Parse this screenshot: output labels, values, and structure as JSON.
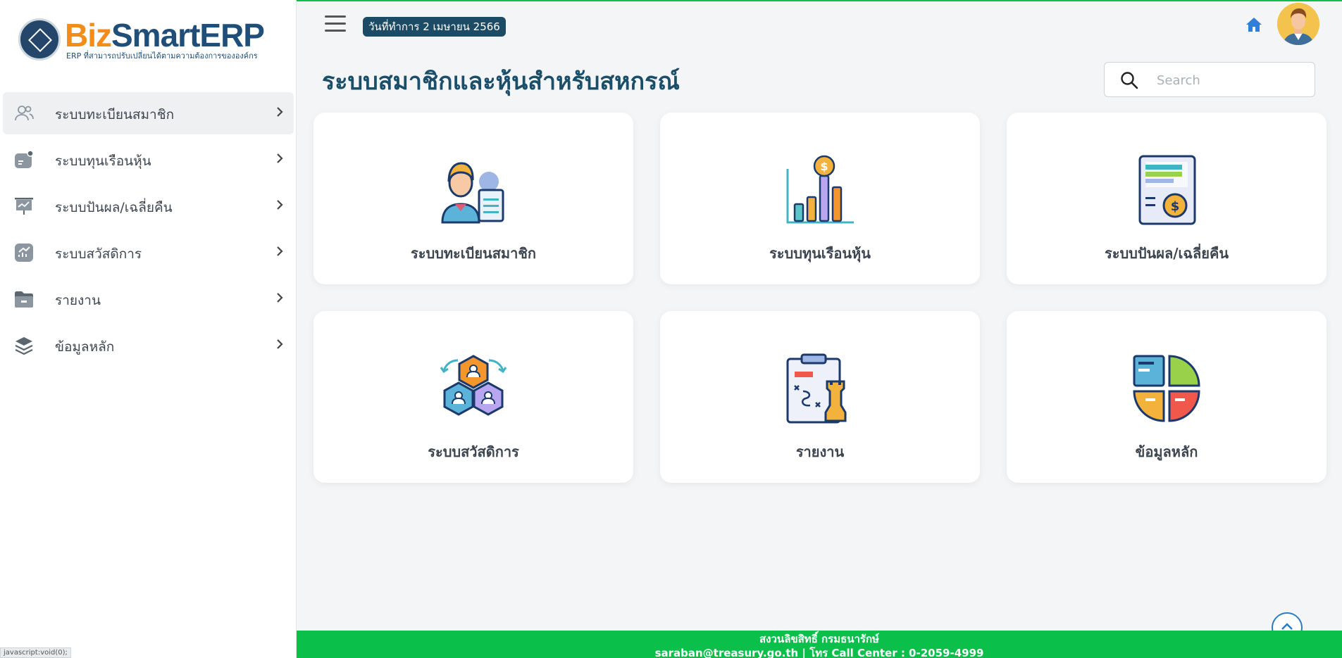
{
  "brand": {
    "name_part1": "Biz",
    "name_part2": "SmartERP",
    "tagline": "ERP ที่สามารถปรับเปลี่ยนได้ตามความต้องการขององค์กร"
  },
  "sidebar": {
    "items": [
      {
        "label": "ระบบทะเบียนสมาชิก",
        "icon": "users-icon",
        "active": true
      },
      {
        "label": "ระบบทุนเรือนหุ้น",
        "icon": "wallet-icon",
        "active": false
      },
      {
        "label": "ระบบปันผล/เฉลี่ยคืน",
        "icon": "presentation-chart-icon",
        "active": false
      },
      {
        "label": "ระบบสวัสดิการ",
        "icon": "trending-chart-icon",
        "active": false
      },
      {
        "label": "รายงาน",
        "icon": "folder-icon",
        "active": false
      },
      {
        "label": "ข้อมูลหลัก",
        "icon": "layers-icon",
        "active": false
      }
    ]
  },
  "topbar": {
    "date_badge": "วันที่ทำการ 2 เมษายน 2566"
  },
  "main": {
    "title": "ระบบสมาชิกและหุ้นสำหรับสหกรณ์",
    "search_placeholder": "Search",
    "cards": [
      {
        "label": "ระบบทะเบียนสมาชิก",
        "icon": "member-registry-icon"
      },
      {
        "label": "ระบบทุนเรือนหุ้น",
        "icon": "share-capital-chart-icon"
      },
      {
        "label": "ระบบปันผล/เฉลี่ยคืน",
        "icon": "dividend-document-icon"
      },
      {
        "label": "ระบบสวัสดิการ",
        "icon": "welfare-network-icon"
      },
      {
        "label": "รายงาน",
        "icon": "report-strategy-icon"
      },
      {
        "label": "ข้อมูลหลัก",
        "icon": "master-data-pie-icon"
      }
    ]
  },
  "footer": {
    "line1": "สงวนลิขสิทธิ์ กรมธนารักษ์",
    "line2": "saraban@treasury.go.th | โทร Call Center : 0-2059-4999"
  },
  "status_bar": "javascript:void(0);",
  "colors": {
    "brand_orange": "#f28c1b",
    "brand_navy": "#1f4e79",
    "title_teal": "#1b4e69",
    "footer_green": "#0bbf4b",
    "home_blue": "#2f7ed8"
  }
}
